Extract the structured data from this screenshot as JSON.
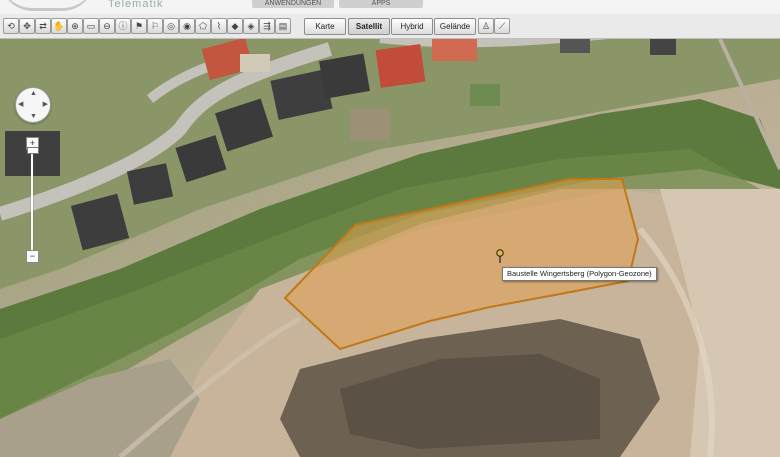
{
  "header": {
    "brand": "Telematik",
    "nav_tabs": [
      "ANWENDUNGEN",
      "APPS"
    ]
  },
  "toolbar": {
    "tools": [
      {
        "name": "refresh-icon",
        "glyph": "⟲"
      },
      {
        "name": "move-icon",
        "glyph": "✥"
      },
      {
        "name": "route-icon",
        "glyph": "⇄"
      },
      {
        "name": "hand-icon",
        "glyph": "✋"
      },
      {
        "name": "zoom-in-icon",
        "glyph": "⊕"
      },
      {
        "name": "zoom-box-icon",
        "glyph": "▭"
      },
      {
        "name": "zoom-out-icon",
        "glyph": "⊖"
      },
      {
        "name": "info-icon",
        "glyph": "ⓘ"
      },
      {
        "name": "pin-flag-icon",
        "glyph": "⚑"
      },
      {
        "name": "pin-poi-icon",
        "glyph": "⚐"
      },
      {
        "name": "radius-icon",
        "glyph": "◎"
      },
      {
        "name": "circle-zone-icon",
        "glyph": "◉"
      },
      {
        "name": "polygon-icon",
        "glyph": "⬠"
      },
      {
        "name": "measure-icon",
        "glyph": "⌇"
      },
      {
        "name": "layer-a-icon",
        "glyph": "◆"
      },
      {
        "name": "layer-b-icon",
        "glyph": "◈"
      },
      {
        "name": "traffic-icon",
        "glyph": "⇶"
      },
      {
        "name": "chart-icon",
        "glyph": "▤"
      }
    ],
    "map_types": [
      "Karte",
      "Satellit",
      "Hybrid",
      "Gelände"
    ],
    "active_map_type": "Satellit",
    "extra_tools": [
      {
        "name": "streetview-icon",
        "glyph": "♙"
      },
      {
        "name": "ruler-icon",
        "glyph": "⟋"
      }
    ]
  },
  "map": {
    "geozone_label": "Baustelle Wingertsberg (Polygon-Geozone)",
    "geozone_fill": "#e0a050",
    "geozone_stroke": "#c07818",
    "zoom_plus": "+",
    "zoom_minus": "−",
    "pan_glyphs": {
      "up": "▲",
      "down": "▼",
      "left": "◀",
      "right": "▶"
    }
  }
}
